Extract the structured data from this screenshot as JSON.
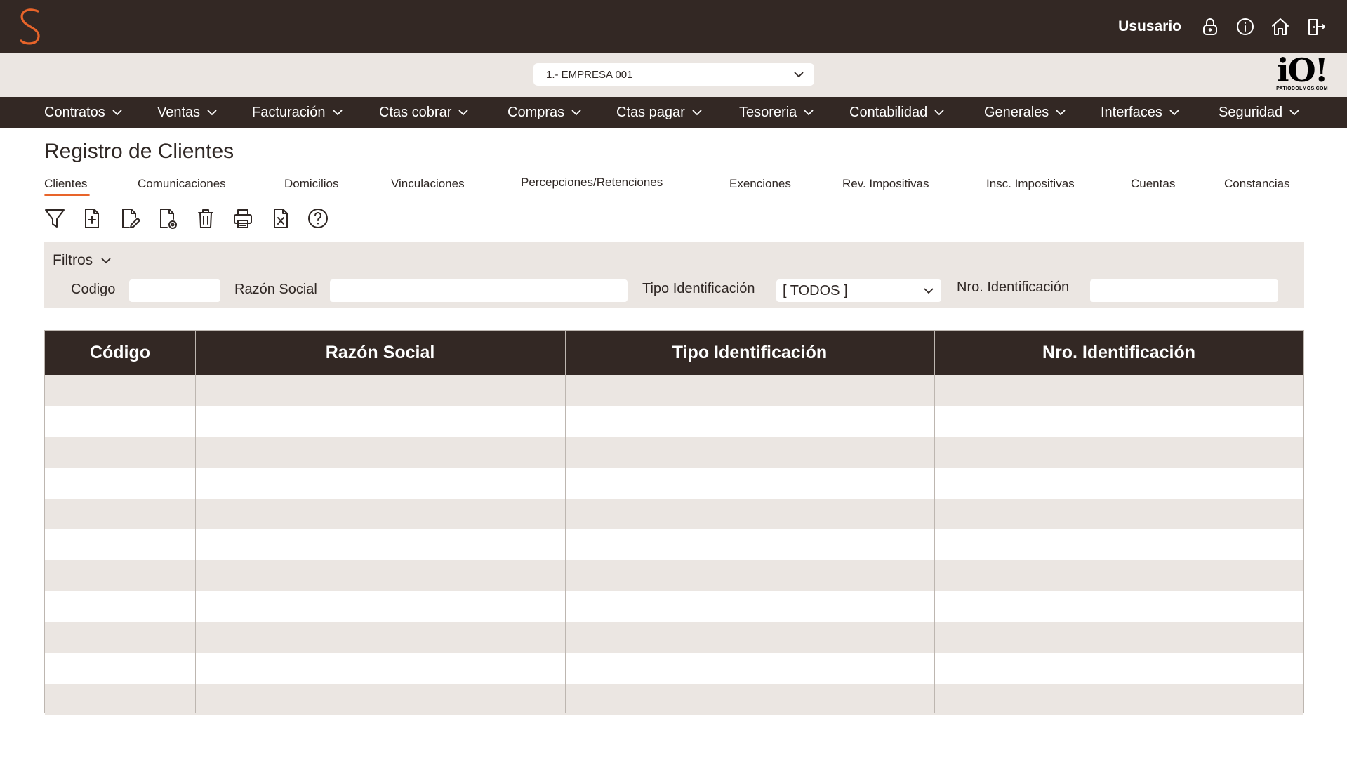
{
  "header": {
    "user_label": "Ususario",
    "icons": [
      "lock-icon",
      "info-icon",
      "home-icon",
      "logout-icon"
    ]
  },
  "company": {
    "selected": "1.- EMPRESA 001"
  },
  "brand": {
    "main": "iO!",
    "sub": "PATIODOLMOS.COM"
  },
  "nav": {
    "items": [
      "Contratos",
      "Ventas",
      "Facturación",
      "Ctas cobrar",
      "Compras",
      "Ctas pagar",
      "Tesoreria",
      "Contabilidad",
      "Generales",
      "Interfaces",
      "Seguridad"
    ]
  },
  "page": {
    "title": "Registro de Clientes"
  },
  "tabs": [
    "Clientes",
    "Comunicaciones",
    "Domicilios",
    "Vinculaciones",
    "Percepciones/Retenciones",
    "Exenciones",
    "Rev. Impositivas",
    "Insc. Impositivas",
    "Cuentas",
    "Constancias"
  ],
  "toolbar": {
    "icons": [
      "filter-icon",
      "new-document-icon",
      "edit-document-icon",
      "view-document-icon",
      "delete-icon",
      "print-icon",
      "excel-export-icon",
      "help-icon"
    ]
  },
  "filters": {
    "title": "Filtros",
    "codigo_label": "Codigo",
    "codigo_value": "",
    "razon_label": "Razón Social",
    "razon_value": "",
    "tipo_label": "Tipo Identificación",
    "tipo_value": "[ TODOS ]",
    "nro_label": "Nro. Identificación",
    "nro_value": ""
  },
  "table": {
    "columns": [
      "Código",
      "Razón Social",
      "Tipo Identificación",
      "Nro. Identificación"
    ],
    "rows": [
      [
        "",
        "",
        "",
        ""
      ],
      [
        "",
        "",
        "",
        ""
      ],
      [
        "",
        "",
        "",
        ""
      ],
      [
        "",
        "",
        "",
        ""
      ],
      [
        "",
        "",
        "",
        ""
      ],
      [
        "",
        "",
        "",
        ""
      ],
      [
        "",
        "",
        "",
        ""
      ],
      [
        "",
        "",
        "",
        ""
      ],
      [
        "",
        "",
        "",
        ""
      ],
      [
        "",
        "",
        "",
        ""
      ],
      [
        "",
        "",
        "",
        ""
      ]
    ]
  },
  "colors": {
    "dark": "#332824",
    "light": "#ebe6e2",
    "accent": "#e8642a"
  }
}
